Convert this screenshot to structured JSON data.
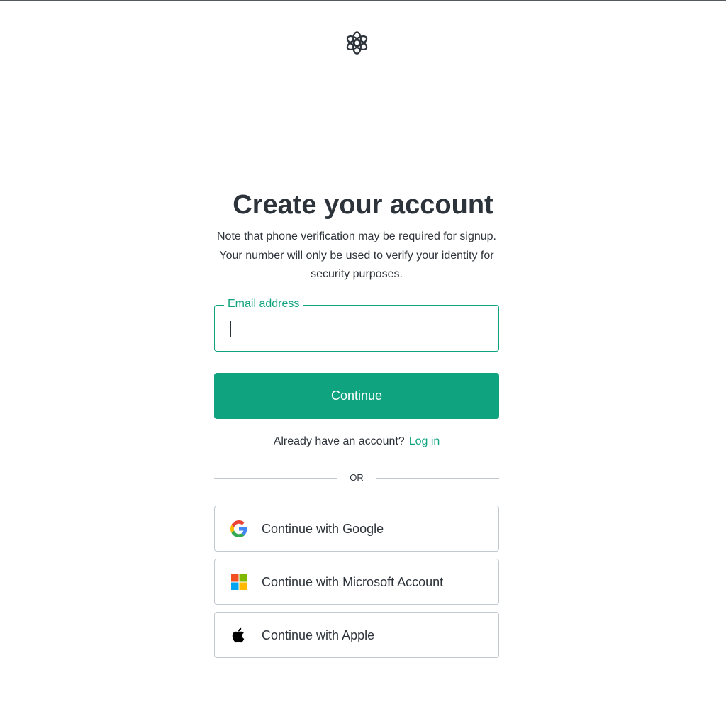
{
  "header": {
    "logo_icon": "openai-logo-icon"
  },
  "main": {
    "title": "Create your account",
    "note": "Note that phone verification may be required for signup. Your number will only be used to verify your identity for security purposes.",
    "email": {
      "label": "Email address",
      "value": "",
      "placeholder": ""
    },
    "continue_label": "Continue",
    "login_prompt": "Already have an account?",
    "login_link": "Log in",
    "divider_text": "OR",
    "social": [
      {
        "label": "Continue with Google",
        "icon": "google-icon"
      },
      {
        "label": "Continue with Microsoft Account",
        "icon": "microsoft-icon"
      },
      {
        "label": "Continue with Apple",
        "icon": "apple-icon"
      }
    ]
  },
  "colors": {
    "accent": "#10a37f",
    "text": "#2d333a",
    "border": "#c2c8d0",
    "background": "#ffffff"
  }
}
